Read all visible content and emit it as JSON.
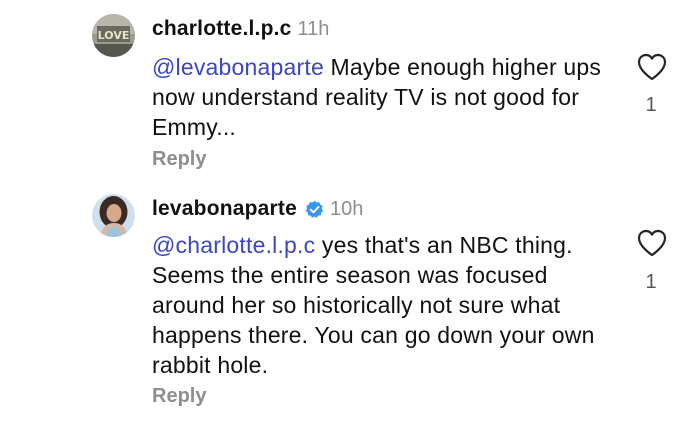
{
  "comments": [
    {
      "username": "charlotte.l.p.c",
      "time": "11h",
      "mention": "@levabonaparte",
      "text": " Maybe enough higher ups now understand reality TV is not good for Emmy...",
      "reply_label": "Reply",
      "like_count": "1",
      "avatar_icon": "love-sign-avatar",
      "verified": false
    },
    {
      "username": "levabonaparte",
      "time": "10h",
      "mention": "@charlotte.l.p.c",
      "text": " yes that's an NBC thing. Seems the entire season was focused around her so historically not sure what happens there. You can go down your own rabbit hole.",
      "reply_label": "Reply",
      "like_count": "1",
      "avatar_icon": "profile-photo-avatar",
      "verified": true
    }
  ],
  "colors": {
    "mention": "#3b46c4",
    "secondary_text": "#8e8e8e",
    "verified_badge": "#3897f0"
  }
}
